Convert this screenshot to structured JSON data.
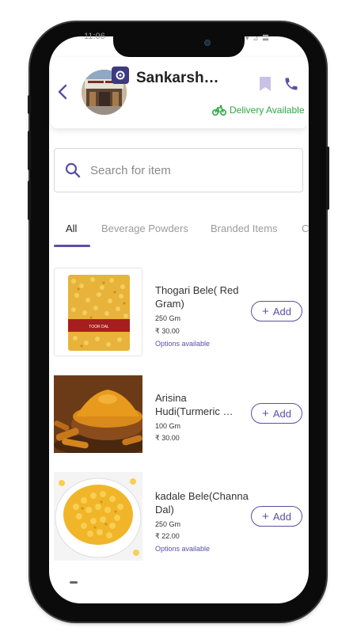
{
  "status_bar": {
    "time": "11:06",
    "indicators": "▾ ⊿ 〓"
  },
  "header": {
    "shop_name": "Sankarsh…",
    "delivery_text": "Delivery Available",
    "accent_color": "#5b4fa6",
    "delivery_color": "#2ea745"
  },
  "search": {
    "placeholder": "Search for item",
    "value": ""
  },
  "tabs": [
    {
      "label": "All",
      "active": true
    },
    {
      "label": "Beverage Powders",
      "active": false
    },
    {
      "label": "Branded Items",
      "active": false
    },
    {
      "label": "C",
      "active": false
    }
  ],
  "products": [
    {
      "name": "Thogari Bele( Red Gram)",
      "quantity": "250 Gm",
      "price": "₹ 30.00",
      "options": "Options available",
      "add_label": "Add",
      "image": "toor-dal-packet",
      "package_label": "TOOR DAL"
    },
    {
      "name": "Arisina Hudi(Turmeric …",
      "quantity": "100 Gm",
      "price": "₹ 30.00",
      "options": "",
      "add_label": "Add",
      "image": "turmeric-powder"
    },
    {
      "name": "kadale Bele(Channa Dal)",
      "quantity": "250 Gm",
      "price": "₹ 22.00",
      "options": "Options available",
      "add_label": "Add",
      "image": "channa-dal-bowl"
    }
  ]
}
